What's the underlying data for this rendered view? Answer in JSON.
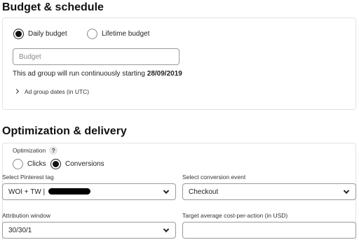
{
  "budget_section": {
    "title": "Budget & schedule",
    "daily_label": "Daily budget",
    "lifetime_label": "Lifetime budget",
    "selected": "daily",
    "budget_placeholder": "Budget",
    "schedule_prefix": "This ad group will run continuously starting ",
    "schedule_date": "28/09/2019",
    "dates_toggle_label": "Ad group dates (in UTC)"
  },
  "optimization_section": {
    "title": "Optimization & delivery",
    "optimization_label": "Optimization",
    "help_glyph": "?",
    "clicks_label": "Clicks",
    "conversions_label": "Conversions",
    "selected": "conversions",
    "tag_label": "Select Pinterest tag",
    "tag_value": "WOI + TW | ",
    "event_label": "Select conversion event",
    "event_value": "Checkout",
    "attribution_label": "Attribution window",
    "attribution_value": "30/30/1",
    "target_cpa_label": "Target average cost-per-action (in USD)",
    "target_cpa_value": ""
  }
}
